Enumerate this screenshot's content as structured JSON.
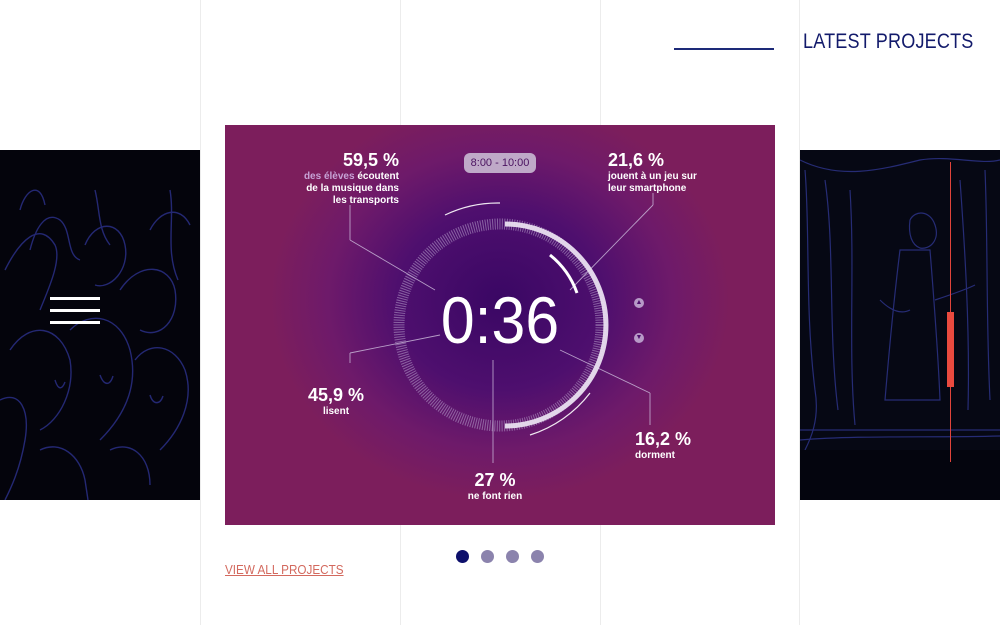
{
  "header": {
    "title": "LATEST PROJECTS"
  },
  "slide": {
    "time_range": "8:00 - 10:00",
    "clock": "0:36",
    "stats": {
      "top_left": {
        "pct": "59,5 %",
        "highlight": "des élèves",
        "desc_rest": "écoutent",
        "desc_line2": "de la musique dans",
        "desc_line3": "les transports"
      },
      "top_right": {
        "pct": "21,6 %",
        "desc_line1": "jouent à un jeu sur",
        "desc_line2": "leur smartphone"
      },
      "middle_left": {
        "pct": "45,9 %",
        "desc": "lisent"
      },
      "bottom_right": {
        "pct": "16,2 %",
        "desc": "dorment"
      },
      "bottom": {
        "pct": "27 %",
        "desc": "ne font rien"
      }
    },
    "colors": {
      "background_center": "#3a0764",
      "background_edge": "#7c1e5c",
      "highlight_text": "#c7a3d6"
    }
  },
  "carousel": {
    "page_count": 4,
    "active_index": 0
  },
  "links": {
    "view_all": "VIEW ALL PROJECTS"
  },
  "icons": {
    "menu": "hamburger-icon",
    "up": "chevron-up-icon",
    "down": "chevron-down-icon"
  },
  "theme": {
    "accent": "#e0443b",
    "navy": "#121a6b",
    "link": "#d3695e"
  }
}
